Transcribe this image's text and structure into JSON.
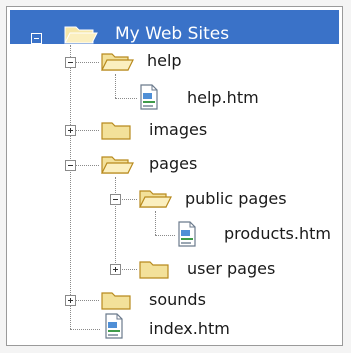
{
  "tree": {
    "root": {
      "label": "My Web Sites",
      "expanded": true,
      "icon": "folder-open-icon"
    },
    "nodes": [
      {
        "id": "help",
        "label": "help",
        "type": "folder",
        "expanded": true
      },
      {
        "id": "help_htm",
        "label": "help.htm",
        "type": "file"
      },
      {
        "id": "images",
        "label": "images",
        "type": "folder",
        "expanded": false
      },
      {
        "id": "pages",
        "label": "pages",
        "type": "folder",
        "expanded": true
      },
      {
        "id": "public_pages",
        "label": "public pages",
        "type": "folder",
        "expanded": true
      },
      {
        "id": "products_htm",
        "label": "products.htm",
        "type": "file"
      },
      {
        "id": "user_pages",
        "label": "user pages",
        "type": "folder",
        "expanded": false
      },
      {
        "id": "sounds",
        "label": "sounds",
        "type": "folder",
        "expanded": false
      },
      {
        "id": "index_htm",
        "label": "index.htm",
        "type": "file"
      }
    ]
  },
  "colors": {
    "root_bar": "#3a72c8",
    "folder_fill": "#f3e19a",
    "folder_stroke": "#b88a1e",
    "file_stroke": "#6b7a8c"
  }
}
